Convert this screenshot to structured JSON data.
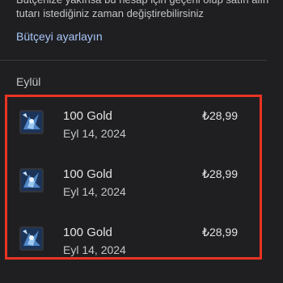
{
  "info": {
    "line1": "Bütçenize yakınsa bu hesap için geçerli olup satın alın",
    "line2": "tutarı istediğiniz zaman değiştirebilirsiniz"
  },
  "budget_link": "Bütçeyi ayarlayın",
  "month": "Eylül",
  "transactions": [
    {
      "title": "100 Gold",
      "date": "Eyl 14, 2024",
      "price": "₺28,99",
      "icon": "game-item-icon"
    },
    {
      "title": "100 Gold",
      "date": "Eyl 14, 2024",
      "price": "₺28,99",
      "icon": "game-item-icon"
    },
    {
      "title": "100 Gold",
      "date": "Eyl 14, 2024",
      "price": "₺28,99",
      "icon": "game-item-icon"
    }
  ],
  "colors": {
    "background": "#1f1f21",
    "link": "#a8c7fa",
    "highlight": "#ea3323"
  }
}
